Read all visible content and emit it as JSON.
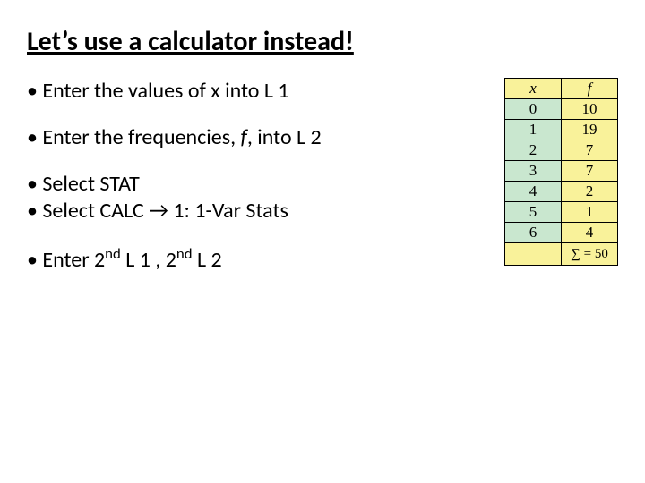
{
  "title": "Let’s use a calculator instead!",
  "bullets": {
    "b1": "• Enter the values of x into L 1",
    "b2_pre": "• Enter the frequencies, ",
    "b2_f": "f",
    "b2_post": ", into L 2",
    "b3": "• Select STAT",
    "b4_pre": "• Select CALC ",
    "b4_post": " 1: 1-Var Stats",
    "b5_pre": "• Enter 2",
    "b5_sup1": "nd",
    "b5_mid": " L 1 , 2",
    "b5_sup2": "nd",
    "b5_post": " L 2"
  },
  "chart_data": {
    "type": "table",
    "headers": {
      "x": "x",
      "f": "f"
    },
    "rows": [
      {
        "x": "0",
        "f": "10"
      },
      {
        "x": "1",
        "f": "19"
      },
      {
        "x": "2",
        "f": "7"
      },
      {
        "x": "3",
        "f": "7"
      },
      {
        "x": "4",
        "f": "2"
      },
      {
        "x": "5",
        "f": "1"
      },
      {
        "x": "6",
        "f": "4"
      }
    ],
    "sum_label": "∑ = 50"
  }
}
